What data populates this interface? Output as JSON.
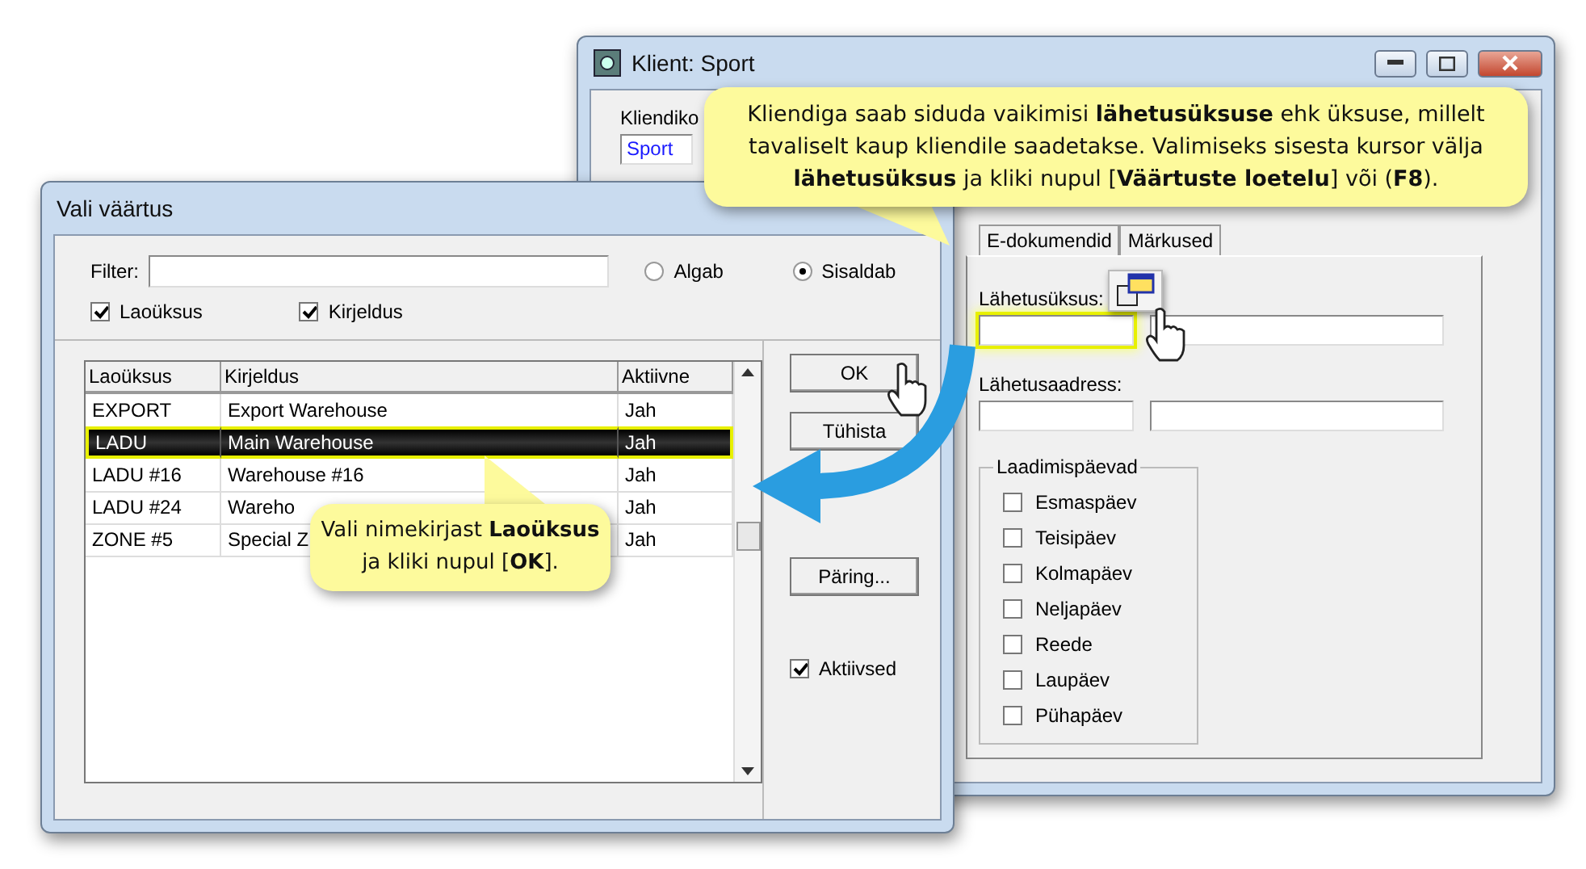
{
  "client_window": {
    "title": "Klient: Sport",
    "client_code_label": "Kliendiko",
    "client_code_value": "Sport",
    "tabs": [
      {
        "label": "E-dokumendid",
        "selected": false
      },
      {
        "label": "Märkused",
        "selected": false
      }
    ],
    "shipping_unit": {
      "label": "Lähetusüksus:",
      "highlighted": true
    },
    "shipping_address": {
      "label": "Lähetusaadress:"
    },
    "loading_days": {
      "title": "Laadimispäevad",
      "days": [
        {
          "label": "Esmaspäev",
          "checked": false
        },
        {
          "label": "Teisipäev",
          "checked": false
        },
        {
          "label": "Kolmapäev",
          "checked": false
        },
        {
          "label": "Neljapäev",
          "checked": false
        },
        {
          "label": "Reede",
          "checked": false
        },
        {
          "label": "Laupäev",
          "checked": false
        },
        {
          "label": "Pühapäev",
          "checked": false
        }
      ]
    }
  },
  "picker_window": {
    "title": "Vali väärtus",
    "filter_label": "Filter:",
    "match_modes": [
      {
        "label": "Algab",
        "selected": false
      },
      {
        "label": "Sisaldab",
        "selected": true
      }
    ],
    "search_in": [
      {
        "label": "Laoüksus",
        "checked": true
      },
      {
        "label": "Kirjeldus",
        "checked": true
      }
    ],
    "table": {
      "columns": [
        "Laoüksus",
        "Kirjeldus",
        "Aktiivne"
      ],
      "rows": [
        {
          "cells": [
            "EXPORT",
            "Export Warehouse",
            "Jah"
          ],
          "selected": false
        },
        {
          "cells": [
            "LADU",
            "Main Warehouse",
            "Jah"
          ],
          "selected": true
        },
        {
          "cells": [
            "LADU #16",
            "Warehouse #16",
            "Jah"
          ],
          "selected": false
        },
        {
          "cells": [
            "LADU #24",
            "Wareho",
            "Jah"
          ],
          "selected": false
        },
        {
          "cells": [
            "ZONE #5",
            "Special Z",
            "Jah"
          ],
          "selected": false
        }
      ]
    },
    "buttons": [
      {
        "kind": "labeled",
        "label": "OK"
      },
      {
        "kind": "labeled",
        "label": "Tühista"
      },
      {
        "kind": "labeled",
        "label": "Päring..."
      }
    ],
    "active_only": {
      "label": "Aktiivsed",
      "checked": true
    }
  },
  "callouts": [
    {
      "text": "Kliendiga saab siduda vaikimisi **lähetusüksuse** ehk üksuse, millelt tavaliselt kaup kliendile saadetakse. Valimiseks sisesta kursor välja **lähetusüksus** ja kliki nupul [**Väärtuste loetelu**] või (**F8**)."
    },
    {
      "text": "Vali nimekirjast **Laoüksus** ja kliki nupul [**OK**]."
    }
  ]
}
